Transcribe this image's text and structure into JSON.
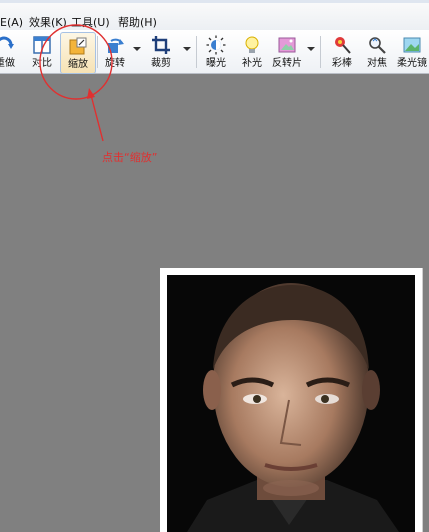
{
  "menu": {
    "items": [
      {
        "label": "E(A)"
      },
      {
        "label": "效果(K)"
      },
      {
        "label": "工具(U)"
      },
      {
        "label": "帮助(H)"
      }
    ]
  },
  "toolbar": {
    "buttons": [
      {
        "label": "重做",
        "icon": "redo-icon"
      },
      {
        "label": "对比",
        "icon": "compare-icon"
      },
      {
        "label": "缩放",
        "icon": "zoom-icon",
        "active": true
      },
      {
        "label": "旋转",
        "icon": "rotate-icon"
      },
      {
        "label": "裁剪",
        "icon": "crop-icon"
      },
      {
        "label": "曝光",
        "icon": "exposure-icon"
      },
      {
        "label": "补光",
        "icon": "fill-light-icon"
      },
      {
        "label": "反转片",
        "icon": "reversal-film-icon"
      },
      {
        "label": "彩棒",
        "icon": "color-wand-icon"
      },
      {
        "label": "对焦",
        "icon": "focus-icon"
      },
      {
        "label": "柔光镜",
        "icon": "soft-focus-icon"
      }
    ]
  },
  "annotation": {
    "text": "点击“缩放”",
    "color": "#e03030"
  },
  "colors": {
    "canvas_bg": "#808080",
    "active_button_bg": "#f6e2b4"
  }
}
